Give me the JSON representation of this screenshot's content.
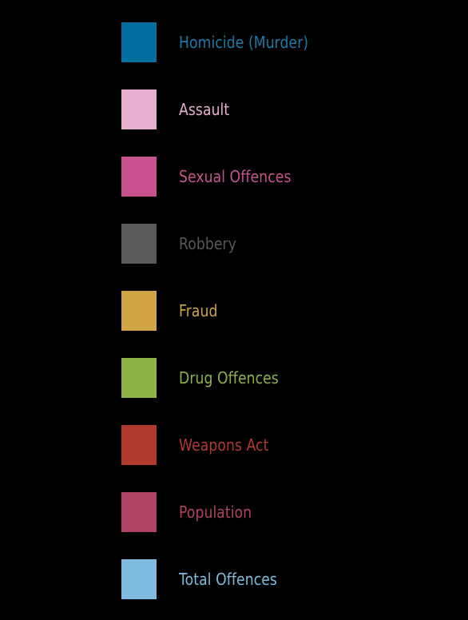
{
  "legend": {
    "items": [
      {
        "label": "Homicide (Murder)",
        "color": "#066e9e",
        "text_color": "#1d7bab"
      },
      {
        "label": "Assault",
        "color": "#e8aecd",
        "text_color": "#e8aecd"
      },
      {
        "label": "Sexual Offences",
        "color": "#c8528f",
        "text_color": "#c8528f"
      },
      {
        "label": "Robbery",
        "color": "#595959",
        "text_color": "#595959"
      },
      {
        "label": "Fraud",
        "color": "#d2a448",
        "text_color": "#d2a448"
      },
      {
        "label": "Drug Offences",
        "color": "#8db348",
        "text_color": "#8db348"
      },
      {
        "label": "Weapons Act",
        "color": "#b03a2e",
        "text_color": "#b03a2e"
      },
      {
        "label": "Population",
        "color": "#b04363",
        "text_color": "#b04363"
      },
      {
        "label": "Total Offences",
        "color": "#7fbbe1",
        "text_color": "#7fbbe1"
      }
    ]
  }
}
